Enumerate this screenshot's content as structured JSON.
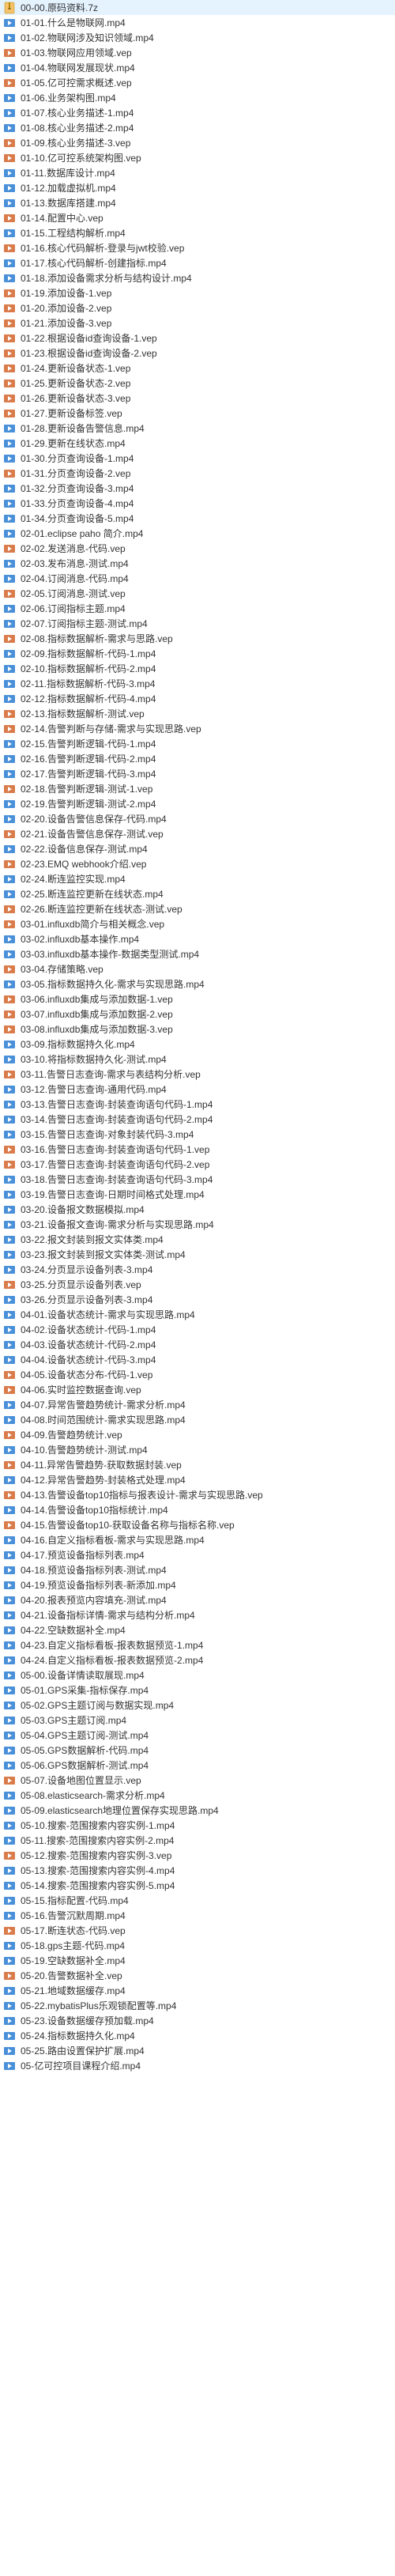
{
  "icons": {
    "archive": "archive-icon",
    "mp4": "video-icon",
    "vep": "vep-icon"
  },
  "files": [
    {
      "name": "00-00.原码资料.7z",
      "type": "archive"
    },
    {
      "name": "01-01.什么是物联网.mp4",
      "type": "mp4"
    },
    {
      "name": "01-02.物联网涉及知识领域.mp4",
      "type": "mp4"
    },
    {
      "name": "01-03.物联网应用领域.vep",
      "type": "vep"
    },
    {
      "name": "01-04.物联网发展现状.mp4",
      "type": "mp4"
    },
    {
      "name": "01-05.亿可控需求概述.vep",
      "type": "vep"
    },
    {
      "name": "01-06.业务架构图.mp4",
      "type": "mp4"
    },
    {
      "name": "01-07.核心业务描述-1.mp4",
      "type": "mp4"
    },
    {
      "name": "01-08.核心业务描述-2.mp4",
      "type": "mp4"
    },
    {
      "name": "01-09.核心业务描述-3.vep",
      "type": "vep"
    },
    {
      "name": "01-10.亿可控系统架构图.vep",
      "type": "vep"
    },
    {
      "name": "01-11.数据库设计.mp4",
      "type": "mp4"
    },
    {
      "name": "01-12.加载虚拟机.mp4",
      "type": "mp4"
    },
    {
      "name": "01-13.数据库搭建.mp4",
      "type": "mp4"
    },
    {
      "name": "01-14.配置中心.vep",
      "type": "vep"
    },
    {
      "name": "01-15.工程结构解析.mp4",
      "type": "mp4"
    },
    {
      "name": "01-16.核心代码解析-登录与jwt校验.vep",
      "type": "vep"
    },
    {
      "name": "01-17.核心代码解析-创建指标.mp4",
      "type": "mp4"
    },
    {
      "name": "01-18.添加设备需求分析与结构设计.mp4",
      "type": "mp4"
    },
    {
      "name": "01-19.添加设备-1.vep",
      "type": "vep"
    },
    {
      "name": "01-20.添加设备-2.vep",
      "type": "vep"
    },
    {
      "name": "01-21.添加设备-3.vep",
      "type": "vep"
    },
    {
      "name": "01-22.根据设备id查询设备-1.vep",
      "type": "vep"
    },
    {
      "name": "01-23.根据设备id查询设备-2.vep",
      "type": "vep"
    },
    {
      "name": "01-24.更新设备状态-1.vep",
      "type": "vep"
    },
    {
      "name": "01-25.更新设备状态-2.vep",
      "type": "vep"
    },
    {
      "name": "01-26.更新设备状态-3.vep",
      "type": "vep"
    },
    {
      "name": "01-27.更新设备标签.vep",
      "type": "vep"
    },
    {
      "name": "01-28.更新设备告警信息.mp4",
      "type": "mp4"
    },
    {
      "name": "01-29.更新在线状态.mp4",
      "type": "mp4"
    },
    {
      "name": "01-30.分页查询设备-1.mp4",
      "type": "mp4"
    },
    {
      "name": "01-31.分页查询设备-2.vep",
      "type": "vep"
    },
    {
      "name": "01-32.分页查询设备-3.mp4",
      "type": "mp4"
    },
    {
      "name": "01-33.分页查询设备-4.mp4",
      "type": "mp4"
    },
    {
      "name": "01-34.分页查询设备-5.mp4",
      "type": "mp4"
    },
    {
      "name": "02-01.eclipse paho 简介.mp4",
      "type": "mp4"
    },
    {
      "name": "02-02.发送消息-代码.vep",
      "type": "vep"
    },
    {
      "name": "02-03.发布消息-测试.mp4",
      "type": "mp4"
    },
    {
      "name": "02-04.订阅消息-代码.mp4",
      "type": "mp4"
    },
    {
      "name": "02-05.订阅消息-测试.vep",
      "type": "vep"
    },
    {
      "name": "02-06.订阅指标主题.mp4",
      "type": "mp4"
    },
    {
      "name": "02-07.订阅指标主题-测试.mp4",
      "type": "mp4"
    },
    {
      "name": "02-08.指标数据解析-需求与思路.vep",
      "type": "vep"
    },
    {
      "name": "02-09.指标数据解析-代码-1.mp4",
      "type": "mp4"
    },
    {
      "name": "02-10.指标数据解析-代码-2.mp4",
      "type": "mp4"
    },
    {
      "name": "02-11.指标数据解析-代码-3.mp4",
      "type": "mp4"
    },
    {
      "name": "02-12.指标数据解析-代码-4.mp4",
      "type": "mp4"
    },
    {
      "name": "02-13.指标数据解析-测试.vep",
      "type": "vep"
    },
    {
      "name": "02-14.告警判断与存储-需求与实现思路.vep",
      "type": "vep"
    },
    {
      "name": "02-15.告警判断逻辑-代码-1.mp4",
      "type": "mp4"
    },
    {
      "name": "02-16.告警判断逻辑-代码-2.mp4",
      "type": "mp4"
    },
    {
      "name": "02-17.告警判断逻辑-代码-3.mp4",
      "type": "mp4"
    },
    {
      "name": "02-18.告警判断逻辑-测试-1.vep",
      "type": "vep"
    },
    {
      "name": "02-19.告警判断逻辑-测试-2.mp4",
      "type": "mp4"
    },
    {
      "name": "02-20.设备告警信息保存-代码.mp4",
      "type": "mp4"
    },
    {
      "name": "02-21.设备告警信息保存-测试.vep",
      "type": "vep"
    },
    {
      "name": "02-22.设备信息保存-测试.mp4",
      "type": "mp4"
    },
    {
      "name": "02-23.EMQ webhook介绍.vep",
      "type": "vep"
    },
    {
      "name": "02-24.断连监控实现.mp4",
      "type": "mp4"
    },
    {
      "name": "02-25.断连监控更新在线状态.mp4",
      "type": "mp4"
    },
    {
      "name": "02-26.断连监控更新在线状态-测试.vep",
      "type": "vep"
    },
    {
      "name": "03-01.influxdb简介与相关概念.vep",
      "type": "vep"
    },
    {
      "name": "03-02.influxdb基本操作.mp4",
      "type": "mp4"
    },
    {
      "name": "03-03.influxdb基本操作-数据类型测试.mp4",
      "type": "mp4"
    },
    {
      "name": "03-04.存储策略.vep",
      "type": "vep"
    },
    {
      "name": "03-05.指标数据持久化-需求与实现思路.mp4",
      "type": "mp4"
    },
    {
      "name": "03-06.influxdb集成与添加数据-1.vep",
      "type": "vep"
    },
    {
      "name": "03-07.influxdb集成与添加数据-2.vep",
      "type": "vep"
    },
    {
      "name": "03-08.influxdb集成与添加数据-3.vep",
      "type": "vep"
    },
    {
      "name": "03-09.指标数据持久化.mp4",
      "type": "mp4"
    },
    {
      "name": "03-10.将指标数据持久化-测试.mp4",
      "type": "mp4"
    },
    {
      "name": "03-11.告警日志查询-需求与表结构分析.vep",
      "type": "vep"
    },
    {
      "name": "03-12.告警日志查询-通用代码.mp4",
      "type": "mp4"
    },
    {
      "name": "03-13.告警日志查询-封装查询语句代码-1.mp4",
      "type": "mp4"
    },
    {
      "name": "03-14.告警日志查询-封装查询语句代码-2.mp4",
      "type": "mp4"
    },
    {
      "name": "03-15.告警日志查询-对象封装代码-3.mp4",
      "type": "mp4"
    },
    {
      "name": "03-16.告警日志查询-封装查询语句代码-1.vep",
      "type": "vep"
    },
    {
      "name": "03-17.告警日志查询-封装查询语句代码-2.vep",
      "type": "vep"
    },
    {
      "name": "03-18.告警日志查询-封装查询语句代码-3.mp4",
      "type": "mp4"
    },
    {
      "name": "03-19.告警日志查询-日期时间格式处理.mp4",
      "type": "mp4"
    },
    {
      "name": "03-20.设备报文数据模拟.mp4",
      "type": "mp4"
    },
    {
      "name": "03-21.设备报文查询-需求分析与实现思路.mp4",
      "type": "mp4"
    },
    {
      "name": "03-22.报文封装到报文实体类.mp4",
      "type": "mp4"
    },
    {
      "name": "03-23.报文封装到报文实体类-测试.mp4",
      "type": "mp4"
    },
    {
      "name": "03-24.分页显示设备列表-3.mp4",
      "type": "mp4"
    },
    {
      "name": "03-25.分页显示设备列表.vep",
      "type": "vep"
    },
    {
      "name": "03-26.分页显示设备列表-3.mp4",
      "type": "mp4"
    },
    {
      "name": "04-01.设备状态统计-需求与实现思路.mp4",
      "type": "mp4"
    },
    {
      "name": "04-02.设备状态统计-代码-1.mp4",
      "type": "mp4"
    },
    {
      "name": "04-03.设备状态统计-代码-2.mp4",
      "type": "mp4"
    },
    {
      "name": "04-04.设备状态统计-代码-3.mp4",
      "type": "mp4"
    },
    {
      "name": "04-05.设备状态分布-代码-1.vep",
      "type": "vep"
    },
    {
      "name": "04-06.实时监控数据查询.vep",
      "type": "vep"
    },
    {
      "name": "04-07.异常告警趋势统计-需求分析.mp4",
      "type": "mp4"
    },
    {
      "name": "04-08.时间范围统计-需求实现思路.mp4",
      "type": "mp4"
    },
    {
      "name": "04-09.告警趋势统计.vep",
      "type": "vep"
    },
    {
      "name": "04-10.告警趋势统计-测试.mp4",
      "type": "mp4"
    },
    {
      "name": "04-11.异常告警趋势-获取数据封装.vep",
      "type": "vep"
    },
    {
      "name": "04-12.异常告警趋势-封装格式处理.mp4",
      "type": "mp4"
    },
    {
      "name": "04-13.告警设备top10指标与报表设计-需求与实现思路.vep",
      "type": "vep"
    },
    {
      "name": "04-14.告警设备top10指标统计.mp4",
      "type": "mp4"
    },
    {
      "name": "04-15.告警设备top10-获取设备名称与指标名称.vep",
      "type": "vep"
    },
    {
      "name": "04-16.自定义指标看板-需求与实现思路.mp4",
      "type": "mp4"
    },
    {
      "name": "04-17.预览设备指标列表.mp4",
      "type": "mp4"
    },
    {
      "name": "04-18.预览设备指标列表-测试.mp4",
      "type": "mp4"
    },
    {
      "name": "04-19.预览设备指标列表-新添加.mp4",
      "type": "mp4"
    },
    {
      "name": "04-20.报表预览内容填充-测试.mp4",
      "type": "mp4"
    },
    {
      "name": "04-21.设备指标详情-需求与结构分析.mp4",
      "type": "mp4"
    },
    {
      "name": "04-22.空缺数据补全.mp4",
      "type": "mp4"
    },
    {
      "name": "04-23.自定义指标看板-报表数据预览-1.mp4",
      "type": "mp4"
    },
    {
      "name": "04-24.自定义指标看板-报表数据预览-2.mp4",
      "type": "mp4"
    },
    {
      "name": "05-00.设备详情读取展现.mp4",
      "type": "mp4"
    },
    {
      "name": "05-01.GPS采集-指标保存.mp4",
      "type": "mp4"
    },
    {
      "name": "05-02.GPS主题订阅与数据实现.mp4",
      "type": "mp4"
    },
    {
      "name": "05-03.GPS主题订阅.mp4",
      "type": "mp4"
    },
    {
      "name": "05-04.GPS主题订阅-测试.mp4",
      "type": "mp4"
    },
    {
      "name": "05-05.GPS数据解析-代码.mp4",
      "type": "mp4"
    },
    {
      "name": "05-06.GPS数据解析-测试.mp4",
      "type": "mp4"
    },
    {
      "name": "05-07.设备地图位置显示.vep",
      "type": "vep"
    },
    {
      "name": "05-08.elasticsearch-需求分析.mp4",
      "type": "mp4"
    },
    {
      "name": "05-09.elasticsearch地理位置保存实现思路.mp4",
      "type": "mp4"
    },
    {
      "name": "05-10.搜索-范围搜索内容实例-1.mp4",
      "type": "mp4"
    },
    {
      "name": "05-11.搜索-范围搜索内容实例-2.mp4",
      "type": "mp4"
    },
    {
      "name": "05-12.搜索-范围搜索内容实例-3.vep",
      "type": "vep"
    },
    {
      "name": "05-13.搜索-范围搜索内容实例-4.mp4",
      "type": "mp4"
    },
    {
      "name": "05-14.搜索-范围搜索内容实例-5.mp4",
      "type": "mp4"
    },
    {
      "name": "05-15.指标配置-代码.mp4",
      "type": "mp4"
    },
    {
      "name": "05-16.告警沉默周期.mp4",
      "type": "mp4"
    },
    {
      "name": "05-17.断连状态-代码.vep",
      "type": "vep"
    },
    {
      "name": "05-18.gps主题-代码.mp4",
      "type": "mp4"
    },
    {
      "name": "05-19.空缺数据补全.mp4",
      "type": "mp4"
    },
    {
      "name": "05-20.告警数据补全.vep",
      "type": "vep"
    },
    {
      "name": "05-21.地域数据缓存.mp4",
      "type": "mp4"
    },
    {
      "name": "05-22.mybatisPlus乐观锁配置等.mp4",
      "type": "mp4"
    },
    {
      "name": "05-23.设备数据缓存预加载.mp4",
      "type": "mp4"
    },
    {
      "name": "05-24.指标数据持久化.mp4",
      "type": "mp4"
    },
    {
      "name": "05-25.路由设置保护扩展.mp4",
      "type": "mp4"
    },
    {
      "name": "05-亿可控项目课程介绍.mp4",
      "type": "mp4"
    }
  ]
}
